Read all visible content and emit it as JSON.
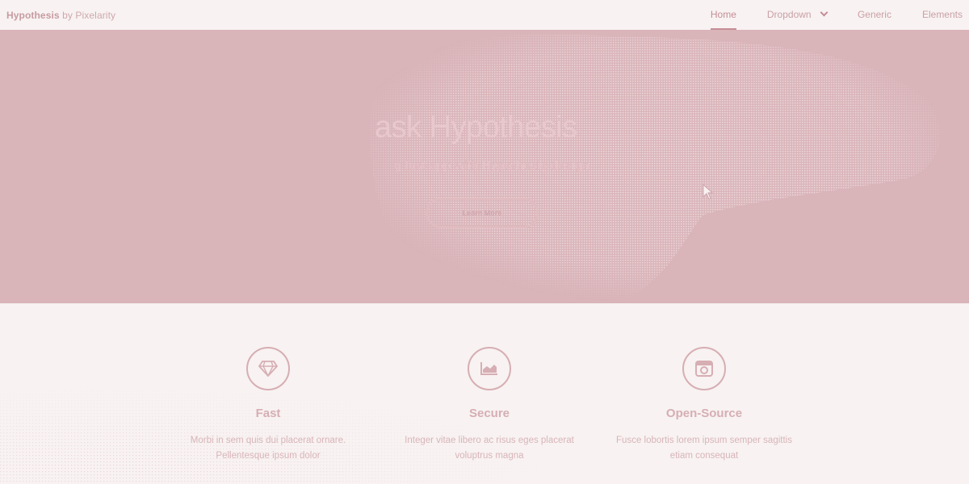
{
  "colors": {
    "hero_bg": "#d9b4b9",
    "page_bg": "#f8f2f2",
    "accent": "#c48e96",
    "muted_text": "#d6aeb3"
  },
  "nav": {
    "brand_name": "Hypothesis",
    "brand_suffix": "by Pixelarity",
    "items": [
      {
        "label": "Home",
        "active": true
      },
      {
        "label": "Dropdown",
        "active": false,
        "icon": "chevron-down-icon"
      },
      {
        "label": "Generic",
        "active": false
      },
      {
        "label": "Elements",
        "active": false
      }
    ]
  },
  "hero": {
    "title": "ask Hypothesis",
    "subtitle": "g fast app with Hypothesis design",
    "button_label": "Learn More"
  },
  "features": [
    {
      "icon": "diamond-icon",
      "title": "Fast",
      "desc_line1": "Morbi in sem quis dui placerat ornare.",
      "desc_line2": "Pellentesque ipsum dolor"
    },
    {
      "icon": "area-chart-icon",
      "title": "Secure",
      "desc_line1": "Integer vitae libero ac risus eges placerat",
      "desc_line2": "voluptrus magna"
    },
    {
      "icon": "camera-icon",
      "title": "Open-Source",
      "desc_line1": "Fusce lobortis lorem ipsum semper sagittis",
      "desc_line2": "etiam consequat"
    }
  ]
}
